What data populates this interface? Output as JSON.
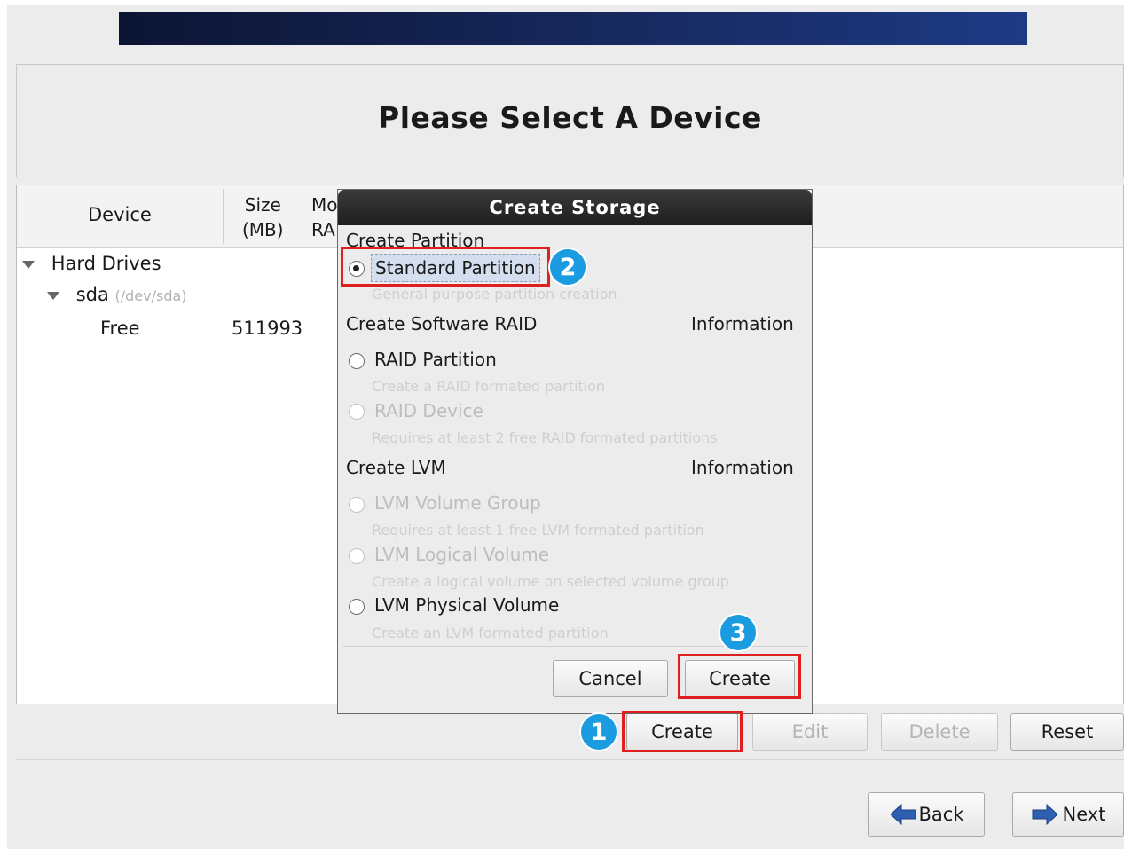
{
  "page": {
    "title": "Please Select A Device"
  },
  "tree": {
    "columns": {
      "device": "Device",
      "size_line1": "Size",
      "size_line2": "(MB)",
      "mount_line1": "Mo",
      "mount_line2": "RA"
    },
    "rows": [
      {
        "label": "Hard Drives"
      },
      {
        "label": "sda",
        "detail": "(/dev/sda)"
      },
      {
        "label": "Free",
        "size": "511993"
      }
    ]
  },
  "actions": {
    "create": "Create",
    "edit": "Edit",
    "delete": "Delete",
    "reset": "Reset"
  },
  "nav": {
    "back": "Back",
    "next": "Next"
  },
  "dialog": {
    "title": "Create Storage",
    "section_partition": "Create Partition",
    "standard_partition": {
      "label": "Standard Partition",
      "desc": "General purpose partition creation",
      "selected": true
    },
    "section_raid": "Create Software RAID",
    "raid_info": "Information",
    "raid_partition": {
      "label": "RAID Partition",
      "desc": "Create a RAID formated partition"
    },
    "raid_device": {
      "label": "RAID Device",
      "desc": "Requires at least 2 free RAID formated partitions"
    },
    "section_lvm": "Create LVM",
    "lvm_info": "Information",
    "lvm_volume_group": {
      "label": "LVM Volume Group",
      "desc": "Requires at least 1 free LVM formated partition"
    },
    "lvm_logical_volume": {
      "label": "LVM Logical Volume",
      "desc": "Create a logical volume on selected volume group"
    },
    "lvm_physical_volume": {
      "label": "LVM Physical Volume",
      "desc": "Create an LVM formated partition"
    },
    "cancel": "Cancel",
    "create": "Create"
  },
  "annotations": {
    "step1": "1",
    "step2": "2",
    "step3": "3"
  },
  "colors": {
    "highlight": "#e02020",
    "badge": "#1b9be0",
    "banner": "#17295e",
    "nav_arrow": "#2f5fb0"
  }
}
